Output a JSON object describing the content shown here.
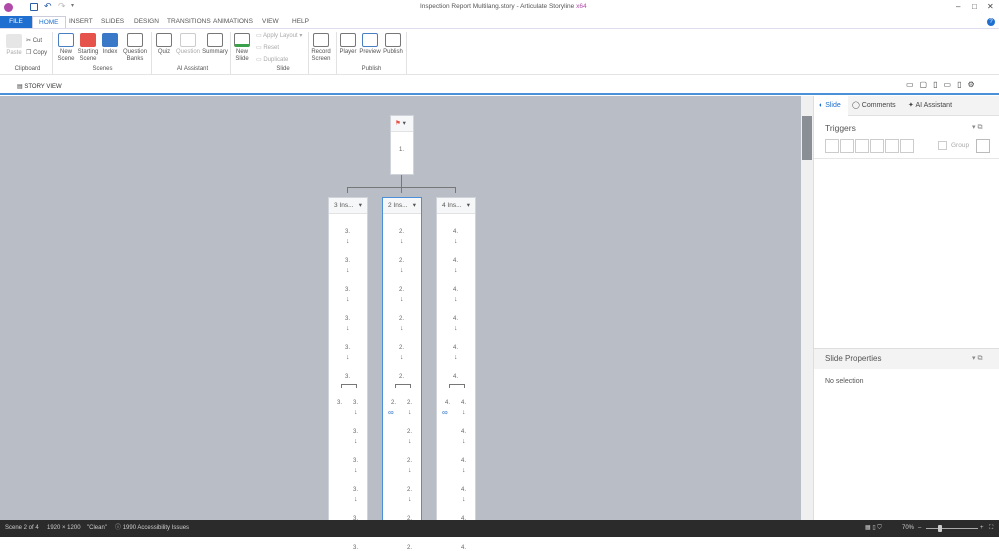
{
  "window": {
    "title": "Inspection Report Multilang.story - Articulate Storyline",
    "edition": "x64",
    "help": "?"
  },
  "tabs": [
    "FILE",
    "HOME",
    "INSERT",
    "SLIDES",
    "DESIGN",
    "TRANSITIONS",
    "ANIMATIONS",
    "VIEW",
    "HELP"
  ],
  "ribbon": {
    "clipboard": {
      "paste": "Paste",
      "cut": "Cut",
      "copy": "Copy",
      "group": "Clipboard"
    },
    "scenes": {
      "new_scene": "New Scene",
      "starting_scene": "Starting Scene",
      "index": "Index",
      "question_banks": "Question Banks",
      "group": "Scenes"
    },
    "ai": {
      "quiz": "Quiz",
      "question": "Question",
      "summary": "Summary",
      "group": "AI Assistant"
    },
    "slide": {
      "new_slide": "New Slide",
      "apply_layout": "Apply Layout",
      "reset": "Reset",
      "duplicate": "Duplicate",
      "record_screen": "Record Screen",
      "group": "Slide"
    },
    "publish": {
      "player": "Player",
      "preview": "Preview",
      "publish": "Publish",
      "group": "Publish"
    }
  },
  "story_view": {
    "label": "STORY VIEW"
  },
  "canvas": {
    "start": {
      "label": "1."
    },
    "scenes": [
      {
        "title": "3 Ins...",
        "num": "3.",
        "selected": false
      },
      {
        "title": "2 Ins...",
        "num": "2.",
        "selected": true
      },
      {
        "title": "4 Ins...",
        "num": "4.",
        "selected": false
      }
    ]
  },
  "panel": {
    "tabs": [
      "Slide",
      "Comments",
      "AI Assistant"
    ],
    "triggers": "Triggers",
    "group": "Group",
    "slide_properties": "Slide Properties",
    "no_selection": "No selection"
  },
  "status": {
    "scene": "Scene 2 of 4",
    "size": "1920 × 1200",
    "state": "\"Clean\"",
    "accessibility": "1990 Accessibility Issues",
    "zoom": "70%"
  },
  "colors": {
    "accent": "#1e6fd0",
    "canvas": "#b9bec6"
  }
}
